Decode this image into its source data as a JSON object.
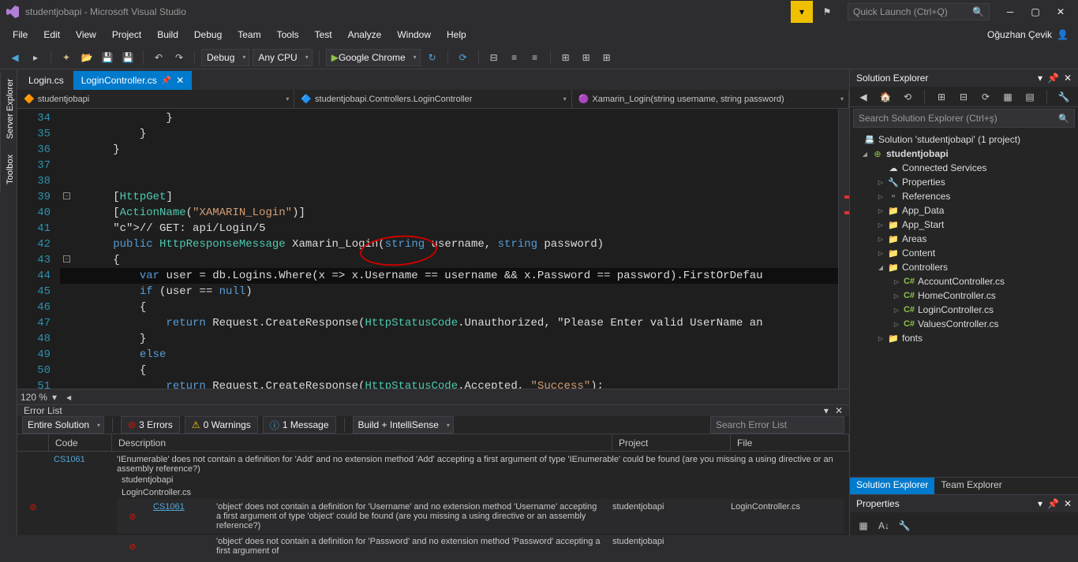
{
  "title": "studentjobapi - Microsoft Visual Studio",
  "quick_launch": "Quick Launch (Ctrl+Q)",
  "user": "Oğuzhan Çevik",
  "menu": [
    "File",
    "Edit",
    "View",
    "Project",
    "Build",
    "Debug",
    "Team",
    "Tools",
    "Test",
    "Analyze",
    "Window",
    "Help"
  ],
  "toolbar": {
    "config": "Debug",
    "platform": "Any CPU",
    "run": "Google Chrome"
  },
  "left_tabs": [
    "Server Explorer",
    "Toolbox"
  ],
  "doc_tabs": [
    {
      "label": "Login.cs",
      "active": false
    },
    {
      "label": "LoginController.cs",
      "active": true,
      "pinned": true
    }
  ],
  "nav": {
    "a": "studentjobapi",
    "b": "studentjobapi.Controllers.LoginController",
    "c": "Xamarin_Login(string username, string password)"
  },
  "lines": [
    34,
    35,
    36,
    37,
    38,
    39,
    40,
    41,
    42,
    43,
    44,
    45,
    46,
    47,
    48,
    49,
    50,
    51
  ],
  "code": [
    "                }",
    "            }",
    "        }",
    "",
    "",
    "        [HttpGet]",
    "        [ActionName(\"XAMARIN_Login\")]",
    "        // GET: api/Login/5",
    "        public HttpResponseMessage Xamarin_Login(string username, string password)",
    "        {",
    "            var user = db.Logins.Where(x => x.Username == username && x.Password == password).FirstOrDefau",
    "            if (user == null)",
    "            {",
    "                return Request.CreateResponse(HttpStatusCode.Unauthorized, \"Please Enter valid UserName an",
    "            }",
    "            else",
    "            {",
    "                return Request.CreateResponse(HttpStatusCode.Accepted, \"Success\");"
  ],
  "zoom": "120 %",
  "errlist": {
    "title": "Error List",
    "scope": "Entire Solution",
    "errors": "3 Errors",
    "warnings": "0 Warnings",
    "messages": "1 Message",
    "filter": "Build + IntelliSense",
    "search": "Search Error List",
    "cols": {
      "code": "Code",
      "desc": "Description",
      "project": "Project",
      "file": "File"
    },
    "rows": [
      {
        "code": "CS1061",
        "desc": "'IEnumerable<object>' does not contain a definition for 'Add' and no extension method 'Add' accepting a first argument of type 'IEnumerable<object>' could be found (are you missing a using directive or an assembly reference?)",
        "project": "studentjobapi",
        "file": "LoginController.cs",
        "link": false
      },
      {
        "code": "CS1061",
        "desc": "'object' does not contain a definition for 'Username' and no extension method 'Username' accepting a first argument of type 'object' could be found (are you missing a using directive or an assembly reference?)",
        "project": "studentjobapi",
        "file": "LoginController.cs",
        "link": true
      },
      {
        "code": "",
        "desc": "'object' does not contain a definition for 'Password' and no extension method 'Password' accepting a first argument of",
        "project": "studentjobapi",
        "file": "",
        "link": false
      }
    ]
  },
  "solexp": {
    "title": "Solution Explorer",
    "search": "Search Solution Explorer (Ctrl+ş)",
    "root": "Solution 'studentjobapi' (1 project)",
    "project": "studentjobapi",
    "items": [
      "Connected Services",
      "Properties",
      "References",
      "App_Data",
      "App_Start",
      "Areas",
      "Content",
      "Controllers",
      "fonts"
    ],
    "controllers": [
      "AccountController.cs",
      "HomeController.cs",
      "LoginController.cs",
      "ValuesController.cs"
    ],
    "bottomtabs": [
      "Solution Explorer",
      "Team Explorer"
    ]
  },
  "props": {
    "title": "Properties"
  }
}
